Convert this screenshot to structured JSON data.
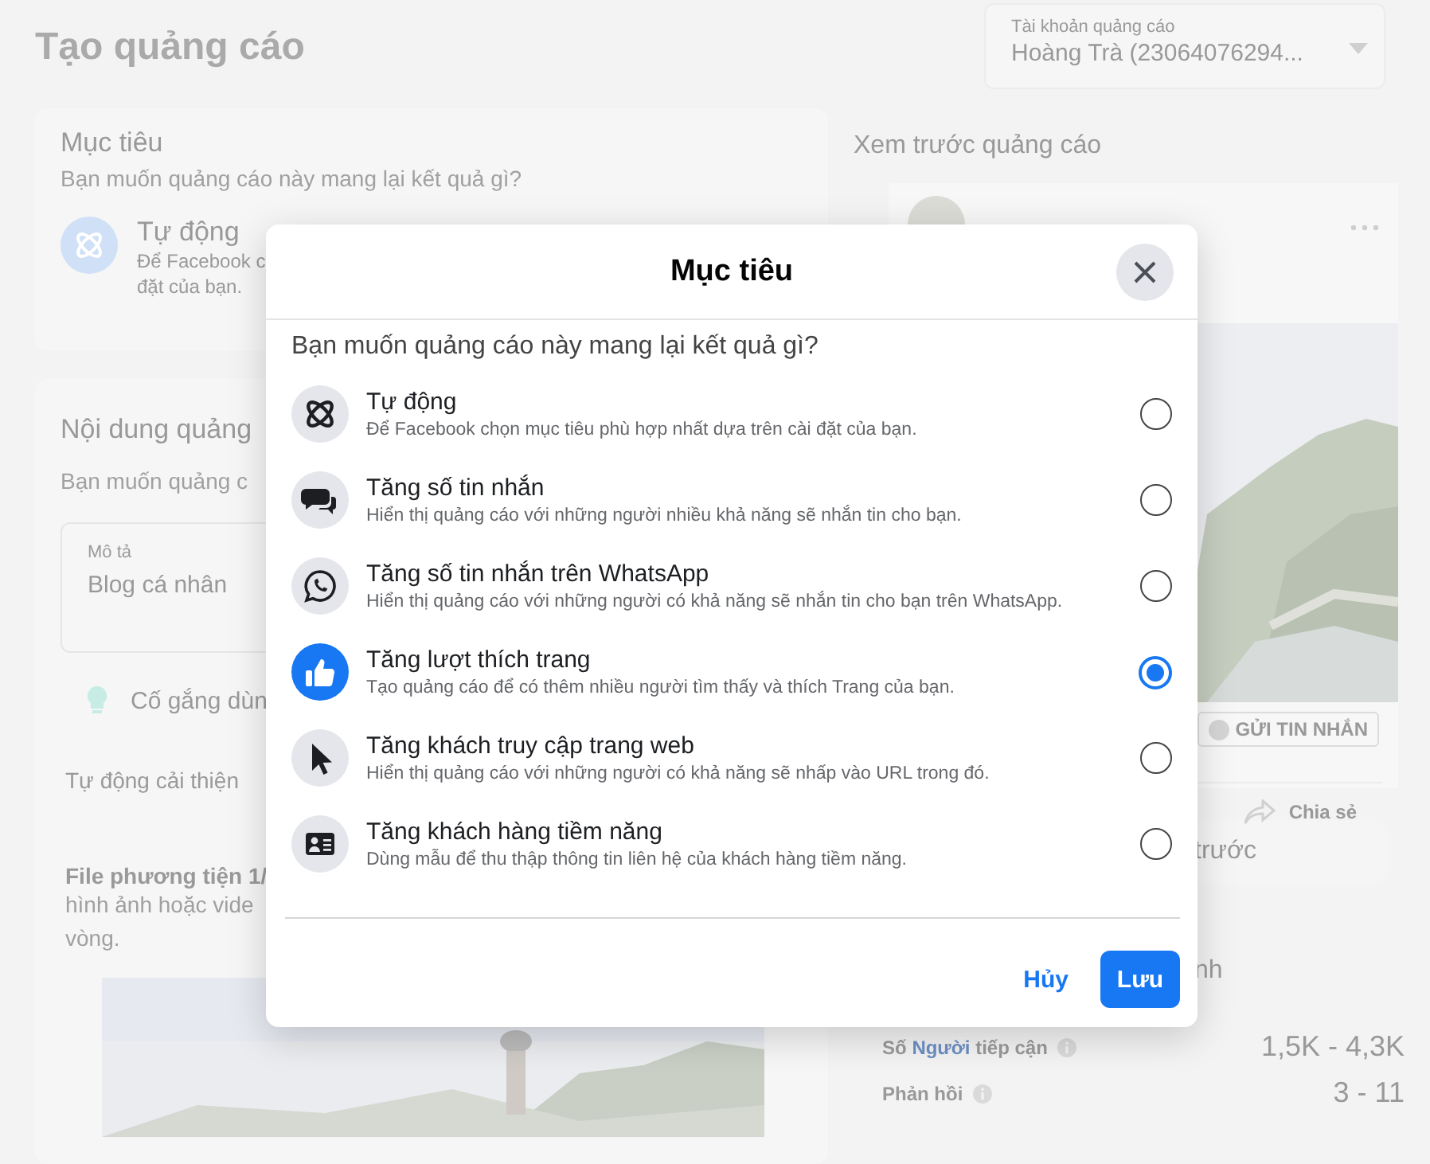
{
  "page": {
    "title": "Tạo quảng cáo"
  },
  "account": {
    "label": "Tài khoản quảng cáo",
    "value": "Hoàng Trà (23064076294..."
  },
  "objective_card": {
    "title": "Mục tiêu",
    "subtitle": "Bạn muốn quảng cáo này mang lại kết quả gì?",
    "choice_title": "Tự động",
    "choice_lines": [
      "Để Facebook c",
      "đặt của bạn."
    ]
  },
  "content_card": {
    "title": "Nội dung quảng",
    "subtitle": "Bạn muốn quảng c",
    "field": {
      "label": "Mô tả",
      "value": "Blog cá nhân"
    },
    "tip": "Cố gắng dùn",
    "auto_improve": "Tự động cải thiện",
    "media_title": "File phương tiện 1/",
    "media_lines": [
      "hình ảnh hoặc vide",
      "vòng."
    ]
  },
  "preview": {
    "title": "Xem trước quảng cáo",
    "cta": "GỬI TIN NHẮN",
    "share": "Chia sẻ",
    "section_fragment": "trước",
    "heading_fragment": "nh",
    "stats": [
      {
        "prefix": "Số",
        "link": "Người",
        "suffix": "tiếp cận",
        "value": "1,5K - 4,3K"
      },
      {
        "prefix": "Phản hồi",
        "value": "3 - 11"
      }
    ]
  },
  "modal": {
    "title": "Mục tiêu",
    "question": "Bạn muốn quảng cáo này mang lại kết quả gì?",
    "options": [
      {
        "kind": "auto",
        "title": "Tự động",
        "description": "Để Facebook chọn mục tiêu phù hợp nhất dựa trên cài đặt của bạn.",
        "selected": false
      },
      {
        "kind": "messages",
        "title": "Tăng số tin nhắn",
        "description": "Hiển thị quảng cáo với những người nhiều khả năng sẽ nhắn tin cho bạn.",
        "selected": false
      },
      {
        "kind": "whatsapp",
        "title": "Tăng số tin nhắn trên WhatsApp",
        "description": "Hiển thị quảng cáo với những người có khả năng sẽ nhắn tin cho bạn trên WhatsApp.",
        "selected": false
      },
      {
        "kind": "likes",
        "title": "Tăng lượt thích trang",
        "description": "Tạo quảng cáo để có thêm nhiều người tìm thấy và thích Trang của bạn.",
        "selected": true
      },
      {
        "kind": "traffic",
        "title": "Tăng khách truy cập trang web",
        "description": "Hiển thị quảng cáo với những người có khả năng sẽ nhấp vào URL trong đó.",
        "selected": false
      },
      {
        "kind": "leads",
        "title": "Tăng khách hàng tiềm năng",
        "description": "Dùng mẫu để thu thập thông tin liên hệ của khách hàng tiềm năng.",
        "selected": false
      }
    ],
    "buttons": [
      {
        "kind": "cancel",
        "label": "Hủy"
      },
      {
        "kind": "primary",
        "label": "Lưu"
      }
    ]
  }
}
